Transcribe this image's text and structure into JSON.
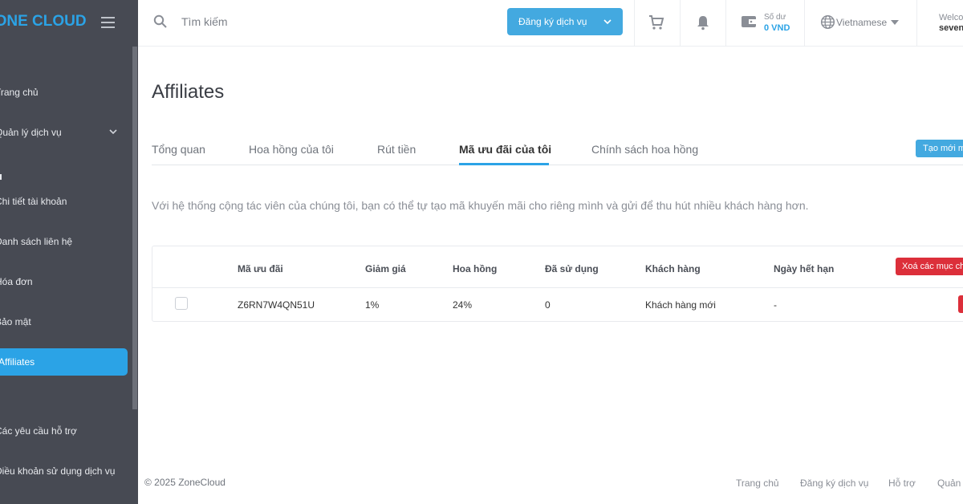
{
  "sidebar": {
    "logo": "ZONE CLOUD",
    "items": [
      {
        "label": "Trang chủ"
      },
      {
        "label": "Quản lý dịch vụ"
      },
      {
        "label": "Chi tiết tài khoản"
      },
      {
        "label": "Danh sách liên hệ"
      },
      {
        "label": "Hóa đơn"
      },
      {
        "label": "Bảo mật"
      },
      {
        "label": "Affiliates"
      },
      {
        "label": "Các yêu cầu hỗ trợ"
      },
      {
        "label": "Điều khoản sử dụng dịch vụ"
      }
    ],
    "active_color": "#2ba3e6"
  },
  "header": {
    "search_placeholder": "Tìm kiếm",
    "register_button": "Đăng ký dịch vụ",
    "balance_label": "Số dư",
    "balance_value": "0 VND",
    "language": "Vietnamese",
    "welcome": "Welcome",
    "username": "sevenlab"
  },
  "main": {
    "title": "Affiliates",
    "tabs": [
      {
        "label": "Tổng quan"
      },
      {
        "label": "Hoa hồng của tôi"
      },
      {
        "label": "Rút tiền"
      },
      {
        "label": "Mã ưu đãi của tôi"
      },
      {
        "label": "Chính sách hoa hồng"
      }
    ],
    "active_tab": "Mã ưu đãi của tôi",
    "create_button": "Tạo mới mã",
    "description": "Với hệ thống cộng tác viên của chúng tôi, bạn có thể tự tạo mã khuyến mãi cho riêng mình và gửi để thu hút nhiều khách hàng hơn.",
    "table": {
      "headers": [
        "Mã ưu đãi",
        "Giảm giá",
        "Hoa hồng",
        "Đã sử dụng",
        "Khách hàng",
        "Ngày hết hạn"
      ],
      "delete_selected_button": "Xoá các mục chọn",
      "rows": [
        {
          "code": "Z6RN7W4QN51U",
          "discount": "1%",
          "commission": "24%",
          "used": "0",
          "customer": "Khách hàng mới",
          "expiry": "-"
        }
      ]
    }
  },
  "footer": {
    "copyright": "© 2025 ZoneCloud",
    "links": [
      "Trang chủ",
      "Đăng ký dịch vụ",
      "Hỗ trợ",
      "Quản lý"
    ]
  },
  "colors": {
    "accent": "#2ba3e6",
    "danger": "#dc2f3a",
    "sidebar_bg": "#474a53"
  }
}
